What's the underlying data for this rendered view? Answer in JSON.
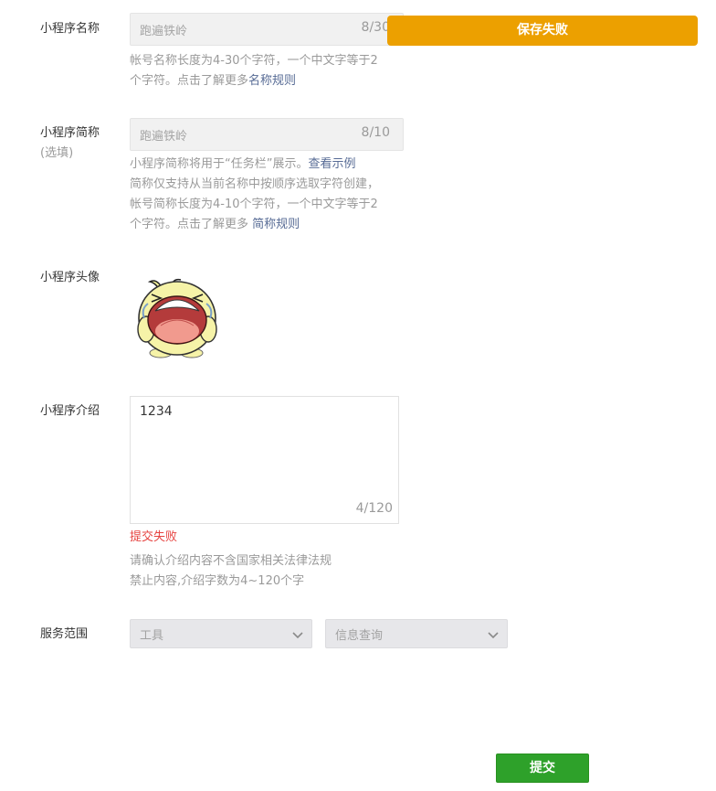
{
  "toast": {
    "text": "保存失败"
  },
  "name": {
    "label": "小程序名称",
    "value": "跑遍铁岭",
    "count": "8/30",
    "hint_line1": "帐号名称长度为4-30个字符，一个中文字等于2",
    "hint_line2_prefix": "个字符。点击了解更多",
    "hint_link": "名称规则"
  },
  "short_name": {
    "label": "小程序简称",
    "sublabel": "(选填)",
    "value": "跑遍铁岭",
    "count": "8/10",
    "hint_line1_prefix": "小程序简称将用于“任务栏”展示。",
    "hint_line1_link": "查看示例",
    "hint_line2": "简称仅支持从当前名称中按顺序选取字符创建，",
    "hint_line3": "帐号简称长度为4-10个字符，一个中文字等于2",
    "hint_line4_prefix": "个字符。点击了解更多 ",
    "hint_link": "简称规则"
  },
  "avatar": {
    "label": "小程序头像",
    "icon": "crying-chick-avatar"
  },
  "intro": {
    "label": "小程序介绍",
    "value": "1234",
    "count": "4/120",
    "error": "提交失败",
    "hint_line1": "请确认介绍内容不含国家相关法律法规",
    "hint_line2": "禁止内容,介绍字数为4~120个字"
  },
  "service": {
    "label": "服务范围",
    "category1": "工具",
    "category2": "信息查询"
  },
  "submit_label": "提交",
  "colors": {
    "toast": "#eca000",
    "submit": "#2ea12a",
    "error": "#e64340",
    "link": "#576b95"
  }
}
